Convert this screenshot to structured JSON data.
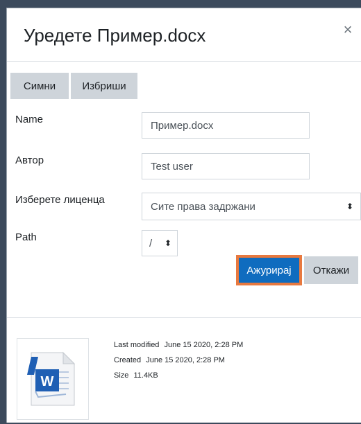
{
  "dialog": {
    "title": "Уредете Пример.docx",
    "close_glyph": "×"
  },
  "toolbar": {
    "download_label": "Симни",
    "delete_label": "Избриши"
  },
  "form": {
    "name_label": "Name",
    "name_value": "Пример.docx",
    "author_label": "Автор",
    "author_value": "Test user",
    "license_label": "Изберете лиценца",
    "license_value": "Сите права задржани",
    "path_label": "Path",
    "path_value": "/"
  },
  "actions": {
    "update_label": "Ажурирај",
    "cancel_label": "Откажи"
  },
  "file_info": {
    "icon": "word-document-icon",
    "last_modified_label": "Last modified",
    "last_modified_value": "June 15 2020, 2:28 PM",
    "created_label": "Created",
    "created_value": "June 15 2020, 2:28 PM",
    "size_label": "Size",
    "size_value": "11.4KB"
  },
  "colors": {
    "primary": "#0f6cbf",
    "highlight": "#e8793f",
    "secondary": "#ced4da"
  }
}
